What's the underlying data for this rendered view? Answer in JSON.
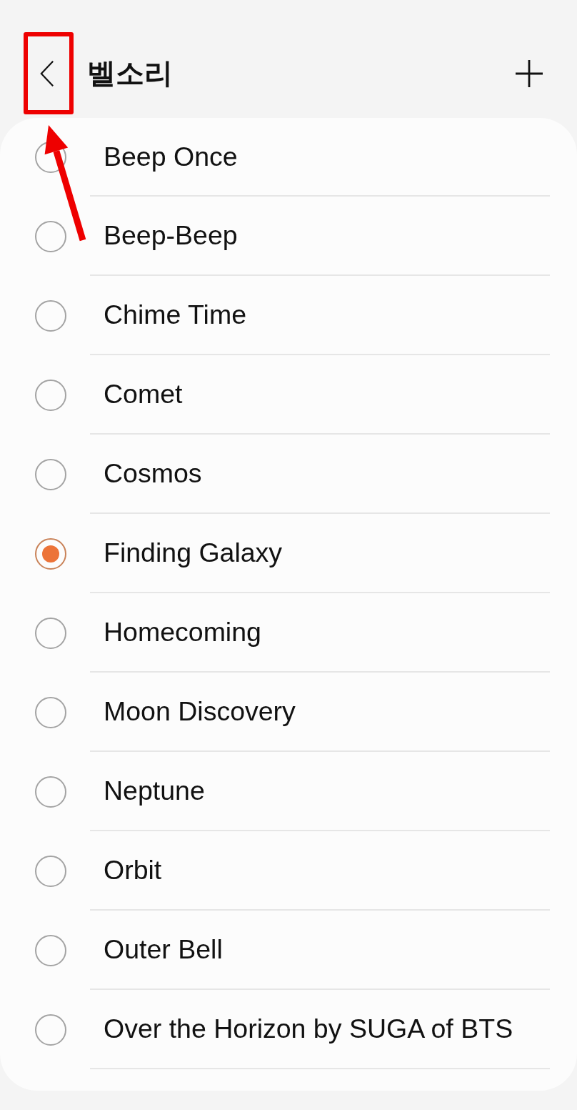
{
  "header": {
    "title": "벨소리"
  },
  "ringtones": [
    {
      "name": "Beep Once",
      "selected": false
    },
    {
      "name": "Beep-Beep",
      "selected": false
    },
    {
      "name": "Chime Time",
      "selected": false
    },
    {
      "name": "Comet",
      "selected": false
    },
    {
      "name": "Cosmos",
      "selected": false
    },
    {
      "name": "Finding Galaxy",
      "selected": true
    },
    {
      "name": "Homecoming",
      "selected": false
    },
    {
      "name": "Moon Discovery",
      "selected": false
    },
    {
      "name": "Neptune",
      "selected": false
    },
    {
      "name": "Orbit",
      "selected": false
    },
    {
      "name": "Outer Bell",
      "selected": false
    },
    {
      "name": "Over the Horizon by SUGA of BTS",
      "selected": false
    }
  ],
  "annotations": [
    {
      "kind": "highlight_box"
    },
    {
      "kind": "arrow"
    }
  ]
}
